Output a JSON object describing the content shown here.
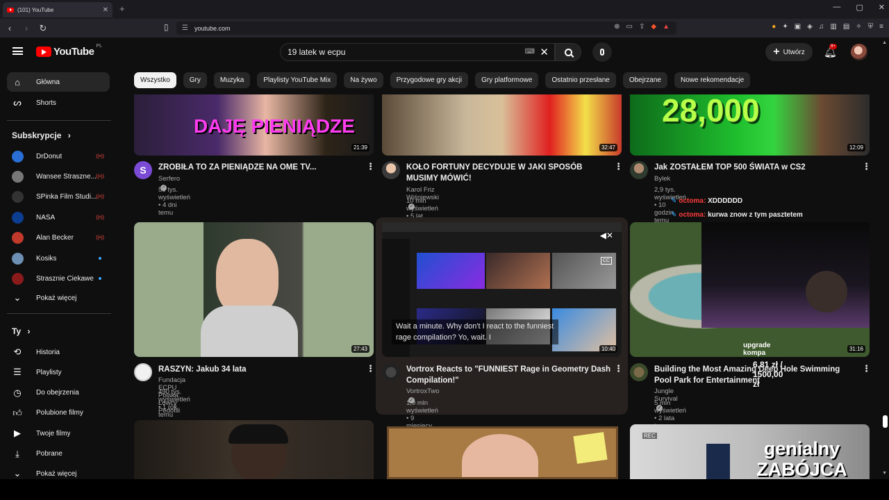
{
  "browser": {
    "tab_title": "(101) YouTube",
    "url": "youtube.com"
  },
  "header": {
    "logo_text": "YouTube",
    "country": "PL",
    "search_value": "19 latek w ecpu",
    "create_label": "Utwórz",
    "notifications_badge": "9+"
  },
  "chips": [
    "Wszystko",
    "Gry",
    "Muzyka",
    "Playlisty YouTube Mix",
    "Na żywo",
    "Przygodowe gry akcji",
    "Gry platformowe",
    "Ostatnio przesłane",
    "Obejrzane",
    "Nowe rekomendacje"
  ],
  "sidebar": {
    "main": [
      {
        "label": "Główna",
        "icon": "home-icon"
      },
      {
        "label": "Shorts",
        "icon": "shorts-icon"
      }
    ],
    "subscriptions_heading": "Subskrypcje",
    "subscriptions": [
      {
        "label": "DrDonut",
        "status": "live",
        "color": "#2a6fd6"
      },
      {
        "label": "Wansee Straszne...",
        "status": "live",
        "color": "#777777"
      },
      {
        "label": "SPinka Film Studi...",
        "status": "live",
        "color": "#333333"
      },
      {
        "label": "NASA",
        "status": "live",
        "color": "#0b3d91"
      },
      {
        "label": "Alan Becker",
        "status": "live",
        "color": "#c0392b"
      },
      {
        "label": "Kosiks",
        "status": "new",
        "color": "#6c8fb3"
      },
      {
        "label": "Strasznie Ciekawe",
        "status": "new",
        "color": "#8b1a1a"
      }
    ],
    "show_more": "Pokaż więcej",
    "you_heading": "Ty",
    "you": [
      {
        "label": "Historia",
        "icon": "history-icon"
      },
      {
        "label": "Playlisty",
        "icon": "playlists-icon"
      },
      {
        "label": "Do obejrzenia",
        "icon": "watch-later-icon"
      },
      {
        "label": "Polubione filmy",
        "icon": "thumbs-up-icon"
      },
      {
        "label": "Twoje filmy",
        "icon": "your-videos-icon"
      },
      {
        "label": "Pobrane",
        "icon": "download-icon"
      }
    ],
    "show_more_2": "Pokaż więcej"
  },
  "videos": [
    {
      "title": "ZROBIŁA TO ZA PIENIĄDZE NA OME TV...",
      "channel": "Serfero",
      "meta": "50 tys. wyświetleń • 4 dni temu",
      "duration": "21:39",
      "thumb_text": "DAJĘ PIENIĄDZE"
    },
    {
      "title": "KOŁO FORTUNY DECYDUJE W JAKI SPOSÓB MUSIMY MÓWIĆ!",
      "channel": "Karol Friz Wiśniewski",
      "meta": "10 mln wyświetleń • 5 lat temu",
      "duration": "32:47"
    },
    {
      "title": "Jak ZOSTAŁEM TOP 500 ŚWIATA w CS2",
      "channel": "Bylek",
      "meta": "2,9 tys. wyświetleń • 10 godzin temu",
      "duration": "12:09",
      "thumb_text": "28,000"
    },
    {
      "title": "RASZYN: Jakub 34 lata",
      "channel": "Fundacja ECPU Polska: Łowcy Pedofili",
      "meta": "490 tys. wyświetleń • 1 rok temu",
      "duration": "27:43"
    },
    {
      "title": "Vortrox Reacts to \"FUNNIEST Rage in Geometry Dash Compilation!\"",
      "channel": "VortroxTwo",
      "meta": "1,9 mln wyświetleń • 9 miesięcy temu",
      "duration": "10:40",
      "caption": "Wait a minute. Why don't I react to the funniest rage compilation? Yo, wait. I"
    },
    {
      "title": "Building the Most Amazing Deep Hole Swimming Pool Park for Entertainment",
      "channel": "Jungle Survival",
      "meta": "5 mln wyświetleń • 2 lata temu",
      "duration": "31:16"
    },
    {
      "title": "",
      "channel": "",
      "meta": "",
      "duration": ""
    },
    {
      "title": "",
      "channel": "",
      "meta": "",
      "duration": ""
    },
    {
      "title": "",
      "channel": "",
      "meta": "",
      "duration": "",
      "thumb_text": "genialny ZABÓJCA",
      "rec": "REC"
    }
  ],
  "overlays": {
    "chat": [
      {
        "user": "octoma:",
        "text": "XDDDDDD"
      },
      {
        "user": "octoma:",
        "text": "kurwa znow z tym pasztetem"
      }
    ],
    "upgrade_label": "upgrade kompa",
    "goal": "6,81 zł / 1500,00 zł"
  }
}
